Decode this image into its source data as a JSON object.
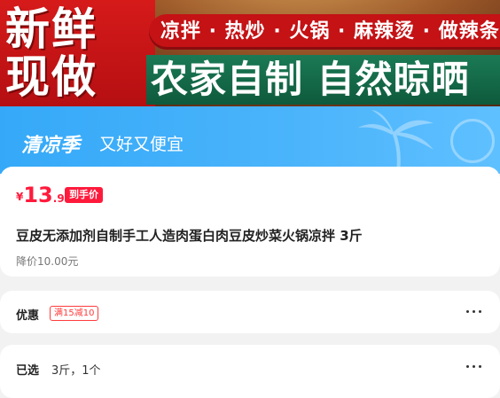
{
  "banner": {
    "headline_line1": "新鲜",
    "headline_line2": "现做",
    "dishes": "凉拌 · 热炒 · 火锅 · 麻辣烫 · 做辣条",
    "slogan": "农家自制 自然晾晒"
  },
  "promo": {
    "season": "清凉季",
    "tagline": "又好又便宜"
  },
  "product": {
    "currency": "¥",
    "price_int": "13",
    "price_dec": ".90",
    "deal_badge": "到手价",
    "title": "豆皮无添加剂自制手工人造肉蛋白肉豆皮炒菜火锅凉拌 3斤",
    "original_price": "降价10.00元"
  },
  "coupon": {
    "label": "优惠",
    "tag": "满15减10"
  },
  "selection": {
    "label": "已选",
    "value": "3斤，1个"
  },
  "colors": {
    "price_red": "#ff1a3c",
    "promo_blue": "#4bb4fb",
    "banner_red": "#c41215",
    "banner_green": "#0e5a3c"
  }
}
